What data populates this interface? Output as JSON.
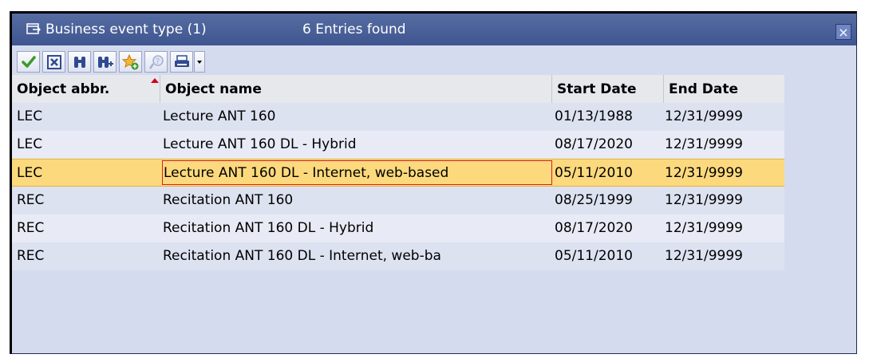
{
  "window": {
    "title": "Business event type (1)",
    "count": "6 Entries found",
    "close_glyph": "×"
  },
  "toolbar": {
    "buttons": [
      {
        "name": "continue-check-icon"
      },
      {
        "name": "cancel-x-icon"
      },
      {
        "name": "find-binoculars-icon"
      },
      {
        "name": "find-next-icon"
      },
      {
        "name": "add-favorite-icon"
      },
      {
        "name": "help-icon"
      },
      {
        "name": "print-icon"
      }
    ]
  },
  "table": {
    "headers": [
      "Object abbr.",
      "Object name",
      "Start Date",
      "End Date"
    ],
    "rows": [
      {
        "abbr": "LEC",
        "name": "Lecture ANT 160",
        "start": "01/13/1988",
        "end": "12/31/9999"
      },
      {
        "abbr": "LEC",
        "name": "Lecture ANT 160 DL - Hybrid",
        "start": "08/17/2020",
        "end": "12/31/9999"
      },
      {
        "abbr": "LEC",
        "name": "Lecture ANT 160 DL - Internet, web-based",
        "start": "05/11/2010",
        "end": "12/31/9999"
      },
      {
        "abbr": "REC",
        "name": "Recitation ANT 160",
        "start": "08/25/1999",
        "end": "12/31/9999"
      },
      {
        "abbr": "REC",
        "name": "Recitation ANT 160 DL - Hybrid",
        "start": "08/17/2020",
        "end": "12/31/9999"
      },
      {
        "abbr": "REC",
        "name": "Recitation ANT 160 DL - Internet, web-ba",
        "start": "05/11/2010",
        "end": "12/31/9999"
      }
    ],
    "selected_row_index": 2
  },
  "colors": {
    "titlebar": "#46609a",
    "selected_row": "#fcd97d",
    "window_bg": "#d5dbee"
  }
}
